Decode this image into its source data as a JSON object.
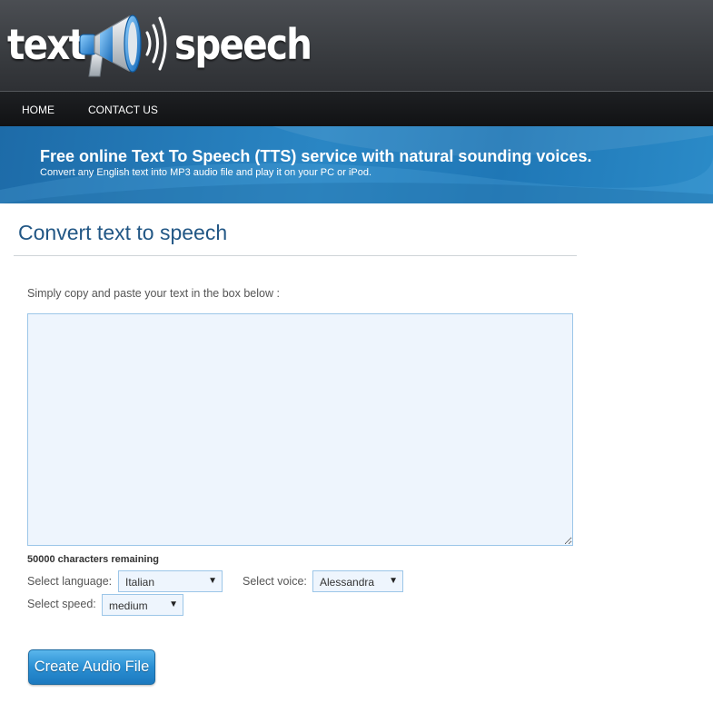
{
  "header": {
    "logo_word_left": "text",
    "logo_word_right": "speech",
    "logo_icon": "megaphone-icon"
  },
  "nav": {
    "items": [
      {
        "label": "HOME"
      },
      {
        "label": "CONTACT US"
      }
    ]
  },
  "banner": {
    "title": "Free online Text To Speech (TTS) service with natural sounding voices.",
    "subtitle": "Convert any English text into MP3 audio file and play it on your PC or iPod."
  },
  "main": {
    "title": "Convert text to speech",
    "instructions": "Simply copy and paste your text in the box below :",
    "textarea_value": "",
    "chars_remaining": "50000 characters remaining",
    "language_label": "Select language:",
    "language_value": "Italian",
    "voice_label": "Select voice:",
    "voice_value": "Alessandra",
    "speed_label": "Select speed:",
    "speed_value": "medium",
    "create_button": "Create Audio File"
  },
  "colors": {
    "header_bg": "#3a3d41",
    "nav_bg": "#16181a",
    "banner_bg": "#2a86c4",
    "title_color": "#225785",
    "input_bg": "#eef5fd",
    "input_border": "#9cc6e8",
    "button_bg": "#2a8fd3"
  }
}
